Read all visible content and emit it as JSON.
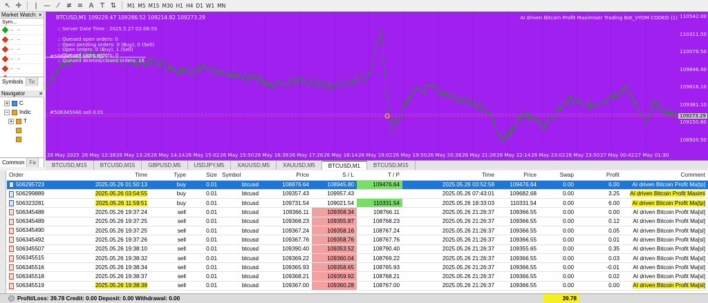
{
  "toolbar": {
    "timeframes": [
      "M1",
      "M5",
      "M15",
      "M30",
      "H1",
      "H4",
      "D1",
      "W1",
      "MN"
    ]
  },
  "market_watch": {
    "title": "Market Watch:",
    "header": "Sym...",
    "rows": [
      {
        "color": "#1aa61a"
      },
      {
        "color": "#d8381e"
      },
      {
        "color": "#d8381e"
      },
      {
        "color": "#d8381e"
      },
      {
        "color": "#d8381e"
      },
      {
        "color": "#d8381e"
      }
    ],
    "tab_symbols": "Symbols",
    "tab_tick": "Tic"
  },
  "navigator": {
    "title": "Navigator",
    "items": [
      {
        "label": "C",
        "expander": "+"
      },
      {
        "label": "Indic",
        "expander": "−"
      },
      {
        "label": "T",
        "expander": "+"
      },
      {
        "label": "",
        "expander": ""
      },
      {
        "label": "",
        "expander": ""
      }
    ],
    "tab_common": "Common",
    "tab_fav": "Fa"
  },
  "chart": {
    "symbol_line": "BTCUSD,M1  109229.47 109286.52 109214.82 109273.29",
    "ea_name": "AI driven Bitcoin Profit Maximiser Trading Bot_VYOM CODED (1)",
    "info_lines": [
      ":: Server Date Time : 2025.5.27   02:06:55",
      "",
      ":: Queued open orders: 0",
      ":: Open pending orders: 0 (Buy), 0 (Sell)",
      ":: Open orders: 0 (Buy), 1 (Sell)",
      ":: Queued close orders: 0",
      ":: Queued deleted/closed orders: 16"
    ],
    "order_label_1": "#506345461 sell 0.01",
    "order_label_2": "#506345040 sell 0.01",
    "price_labels": [
      "110542.00",
      "110311.50",
      "110076.50",
      "109846.40",
      "109616.10",
      "109381.10",
      "109150.80",
      "108920.50"
    ],
    "current_price": "109273.29",
    "time_labels": [
      "26 May 2025",
      "26 May 12:38",
      "26 May 13:26",
      "26 May 14:14",
      "26 May 15:02",
      "26 May 15:50",
      "26 May 16:38",
      "26 May 17:26",
      "26 May 18:14",
      "26 May 19:02",
      "26 May 19:50",
      "26 May 20:38",
      "26 May 21:26",
      "26 May 22:14",
      "26 May 23:02",
      "26 May 23:50",
      "27 May 00:42",
      "27 May 01:30"
    ],
    "colors": {
      "background": "#a020f0",
      "line": "#2e8b2e",
      "grid": "#8a1ad0"
    }
  },
  "chart_tabs": [
    "BTCUSD,M15",
    "BTCUSD,M15",
    "GBPUSD,M5",
    "USDJPY,M5",
    "XAUUSD,M5",
    "XAUUSD,M5",
    "BTCUSD,M1",
    "BTCUSD,M15"
  ],
  "active_chart_tab": 6,
  "orders": {
    "headers": [
      "Order",
      "Time",
      "Type",
      "Size",
      "Symbol",
      "Price",
      "S / L",
      "T / P",
      "Time",
      "Price",
      "Swap",
      "Profit",
      "Comment"
    ],
    "rows": [
      {
        "order": "506295723",
        "time": "2025.05.26 01:50:13",
        "type": "buy",
        "size": "0.01",
        "symbol": "btcusd",
        "price": "108876.64",
        "sl": "108945.80",
        "tp": "109476.64",
        "time2": "2025.05.26 03:52:58",
        "price2": "109476.64",
        "swap": "0.00",
        "profit": "6.00",
        "comment": "AI driven Bitcoin Profit Ma[tp]"
      },
      {
        "order": "506299889",
        "time": "2025.05.26 03:54:55",
        "type": "buy",
        "size": "0.01",
        "symbol": "btcusd",
        "price": "109357.43",
        "sl": "109957.43",
        "tp": "",
        "time2": "2025.05.26 07:43:01",
        "price2": "109682.68",
        "swap": "0.00",
        "profit": "3.25",
        "comment": "AI driven Bitcoin Profit Maximi"
      },
      {
        "order": "506323281",
        "time": "2025.05.26 11:59:51",
        "type": "buy",
        "size": "0.01",
        "symbol": "btcusd",
        "price": "109731.54",
        "sl": "109021.54",
        "tp": "110331.54",
        "time2": "2025.05.26 18:33:03",
        "price2": "110331.54",
        "swap": "0.00",
        "profit": "6.00",
        "comment": "AI driven Bitcoin Profit Ma[tp]"
      },
      {
        "order": "506345488",
        "time": "2025.05.26 19:37:24",
        "type": "sell",
        "size": "0.01",
        "symbol": "btcusd",
        "price": "109366.11",
        "sl": "109358.34",
        "tp": "108766.11",
        "time2": "2025.05.26 21:26:37",
        "price2": "109366.55",
        "swap": "0.00",
        "profit": "0.00",
        "comment": "AI driven Bitcoin Profit Ma[sl]"
      },
      {
        "order": "506345489",
        "time": "2025.05.26 19:37:25",
        "type": "sell",
        "size": "0.01",
        "symbol": "btcusd",
        "price": "109368.23",
        "sl": "109355.87",
        "tp": "108768.23",
        "time2": "2025.05.26 21:26:37",
        "price2": "109366.55",
        "swap": "0.00",
        "profit": "0.12",
        "comment": "AI driven Bitcoin Profit Ma[sl]"
      },
      {
        "order": "506345490",
        "time": "2025.05.26 19:37:25",
        "type": "sell",
        "size": "0.01",
        "symbol": "btcusd",
        "price": "109367.24",
        "sl": "109358.16",
        "tp": "108767.24",
        "time2": "2025.05.26 21:26:37",
        "price2": "109366.55",
        "swap": "0.00",
        "profit": "0.05",
        "comment": "AI driven Bitcoin Profit Ma[sl]"
      },
      {
        "order": "506345492",
        "time": "2025.05.26 19:37:26",
        "type": "sell",
        "size": "0.01",
        "symbol": "btcusd",
        "price": "109367.76",
        "sl": "109358.76",
        "tp": "108767.76",
        "time2": "2025.05.26 21:26:37",
        "price2": "109366.55",
        "swap": "0.00",
        "profit": "0.01",
        "comment": "AI driven Bitcoin Profit Ma[sl]"
      },
      {
        "order": "506345507",
        "time": "2025.05.26 19:38:10",
        "type": "sell",
        "size": "0.01",
        "symbol": "btcusd",
        "price": "109390.40",
        "sl": "109353.52",
        "tp": "108790.40",
        "time2": "2025.05.26 21:26:37",
        "price2": "109355.65",
        "swap": "0.00",
        "profit": "0.35",
        "comment": "AI driven Bitcoin Profit Ma[sl]"
      },
      {
        "order": "506345515",
        "time": "2025.05.26 19:38:32",
        "type": "sell",
        "size": "0.01",
        "symbol": "btcusd",
        "price": "109369.22",
        "sl": "109360.04",
        "tp": "108769.22",
        "time2": "2025.05.26 21:26:37",
        "price2": "109366.55",
        "swap": "0.00",
        "profit": "0.03",
        "comment": "AI driven Bitcoin Profit Ma[sl]"
      },
      {
        "order": "506345516",
        "time": "2025.05.26 19:38:34",
        "type": "sell",
        "size": "0.01",
        "symbol": "btcusd",
        "price": "109365.93",
        "sl": "109358.65",
        "tp": "108765.93",
        "time2": "2025.05.26 21:26:37",
        "price2": "109366.55",
        "swap": "0.00",
        "profit": "-0.01",
        "comment": "AI driven Bitcoin Profit Ma[sl]"
      },
      {
        "order": "506345518",
        "time": "2025.05.26 19:38:37",
        "type": "sell",
        "size": "0.01",
        "symbol": "btcusd",
        "price": "109368.21",
        "sl": "109359.92",
        "tp": "108768.21",
        "time2": "2025.05.26 21:26:37",
        "price2": "109366.55",
        "swap": "0.00",
        "profit": "0.02",
        "comment": "AI driven Bitcoin Profit Ma[sl]"
      },
      {
        "order": "506345519",
        "time": "2025.05.26 19:38:38",
        "type": "sell",
        "size": "0.01",
        "symbol": "btcusd",
        "price": "109367.00",
        "sl": "109360.28",
        "tp": "108767.00",
        "time2": "2025.05.26 21:26:37",
        "price2": "109366.55",
        "swap": "0.00",
        "profit": "0.00",
        "comment": "AI driven Bitcoin Profit Ma[sl]"
      }
    ],
    "footer_text": "Profit/Loss: 39.78  Credit: 0.00  Deposit: 0.00  Withdrawal: 0.00",
    "footer_total": "39.78"
  },
  "colors": {
    "selected_row": "#1c77d8",
    "sl_cell": "#f4a0a0",
    "tp_cell": "#76e066",
    "highlight": "#f6f020"
  }
}
